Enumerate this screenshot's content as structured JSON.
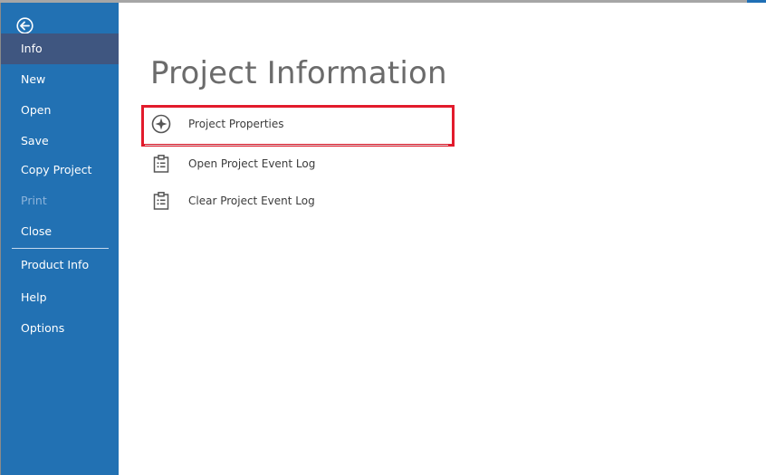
{
  "sidebar": {
    "back_icon": "back-arrow-icon",
    "items": [
      {
        "label": "Info",
        "state": "active"
      },
      {
        "label": "New",
        "state": "normal"
      },
      {
        "label": "Open",
        "state": "normal"
      },
      {
        "label": "Save",
        "state": "normal"
      },
      {
        "label": "Copy Project",
        "state": "normal"
      },
      {
        "label": "Print",
        "state": "disabled"
      },
      {
        "label": "Close",
        "state": "normal"
      },
      {
        "label": "Product Info",
        "state": "normal"
      },
      {
        "label": "Help",
        "state": "normal"
      },
      {
        "label": "Options",
        "state": "normal"
      }
    ]
  },
  "main": {
    "title": "Project Information",
    "actions": [
      {
        "label": "Project Properties",
        "icon": "compass-star-icon",
        "highlighted": true
      },
      {
        "label": "Open Project Event Log",
        "icon": "clipboard-list-icon"
      },
      {
        "label": "Clear Project Event Log",
        "icon": "clipboard-list-icon"
      }
    ]
  },
  "colors": {
    "sidebar_bg": "#2271b3",
    "sidebar_active": "#3f5680",
    "highlight_border": "#e21b2c",
    "title_text": "#6b6b6b"
  }
}
